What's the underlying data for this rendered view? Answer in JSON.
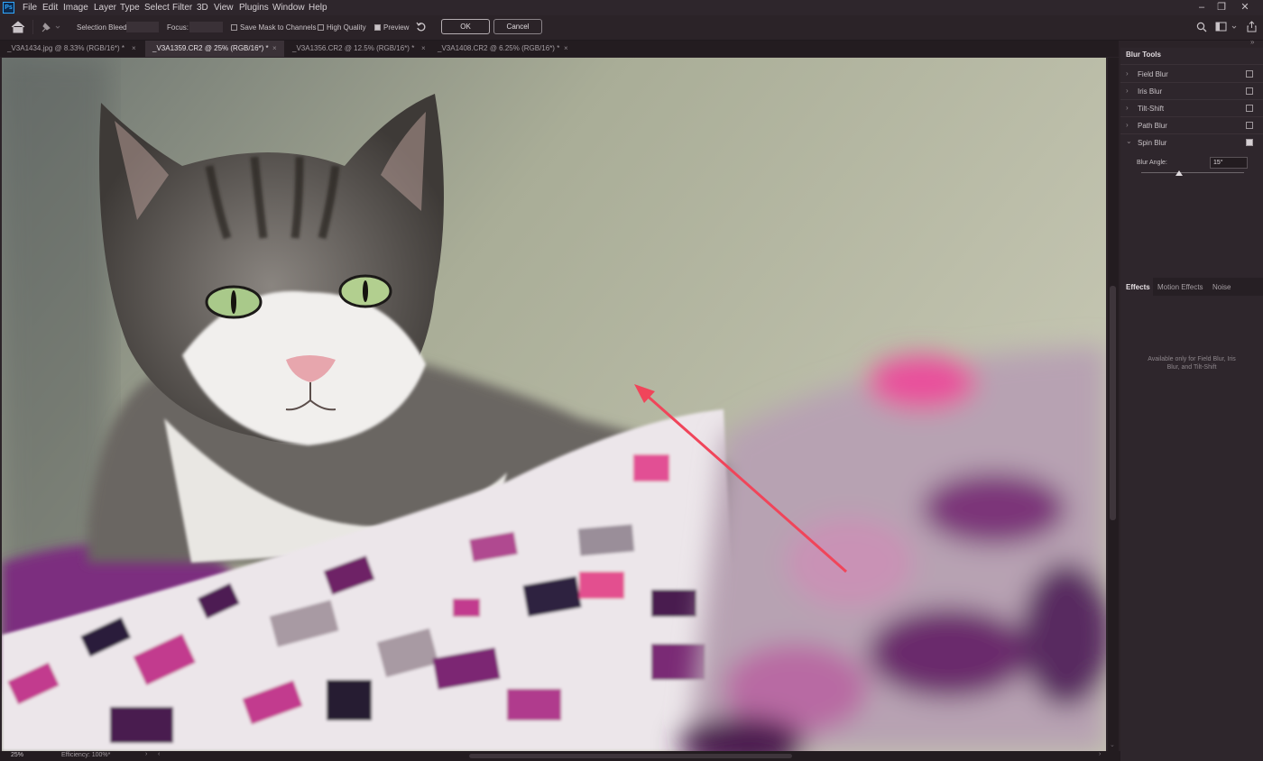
{
  "app": {
    "logo": "Ps"
  },
  "menu": [
    "File",
    "Edit",
    "Image",
    "Layer",
    "Type",
    "Select",
    "Filter",
    "3D",
    "View",
    "Plugins",
    "Window",
    "Help"
  ],
  "window_controls": {
    "minimize": "‒",
    "restore": "❐",
    "close": "✕"
  },
  "options_bar": {
    "selection_bleed_label": "Selection Bleed:",
    "focus_label": "Focus:",
    "save_mask_label": "Save Mask to Channels",
    "save_mask_checked": false,
    "high_quality_label": "High Quality",
    "high_quality_checked": false,
    "preview_label": "Preview",
    "preview_checked": true,
    "ok_label": "OK",
    "cancel_label": "Cancel"
  },
  "tabs": [
    {
      "label": "_V3A1434.jpg @ 8.33% (RGB/16*) *",
      "active": false
    },
    {
      "label": "_V3A1359.CR2 @ 25% (RGB/16*) *",
      "active": true
    },
    {
      "label": "_V3A1356.CR2 @ 12.5% (RGB/16*) *",
      "active": false
    },
    {
      "label": "_V3A1408.CR2 @ 6.25% (RGB/16*) *",
      "active": false
    }
  ],
  "blur_tools": {
    "title": "Blur Tools",
    "items": [
      {
        "label": "Field Blur",
        "checked": false,
        "expanded": false
      },
      {
        "label": "Iris Blur",
        "checked": false,
        "expanded": false
      },
      {
        "label": "Tilt-Shift",
        "checked": false,
        "expanded": false
      },
      {
        "label": "Path Blur",
        "checked": false,
        "expanded": false
      },
      {
        "label": "Spin Blur",
        "checked": true,
        "expanded": true
      }
    ],
    "blur_angle_label": "Blur Angle:",
    "blur_angle_value": "15°",
    "blur_angle_slider": 0.37
  },
  "effects": {
    "tabs": [
      "Effects",
      "Motion Effects",
      "Noise"
    ],
    "active_tab": "Effects",
    "message": "Available only for Field Blur, Iris Blur, and Tilt-Shift"
  },
  "status": {
    "zoom": "25%",
    "efficiency": "Efficiency: 100%*"
  },
  "colors": {
    "accent_arrow": "#f0455a",
    "panel_bg": "#2e262c",
    "app_bg": "#2b2328"
  }
}
